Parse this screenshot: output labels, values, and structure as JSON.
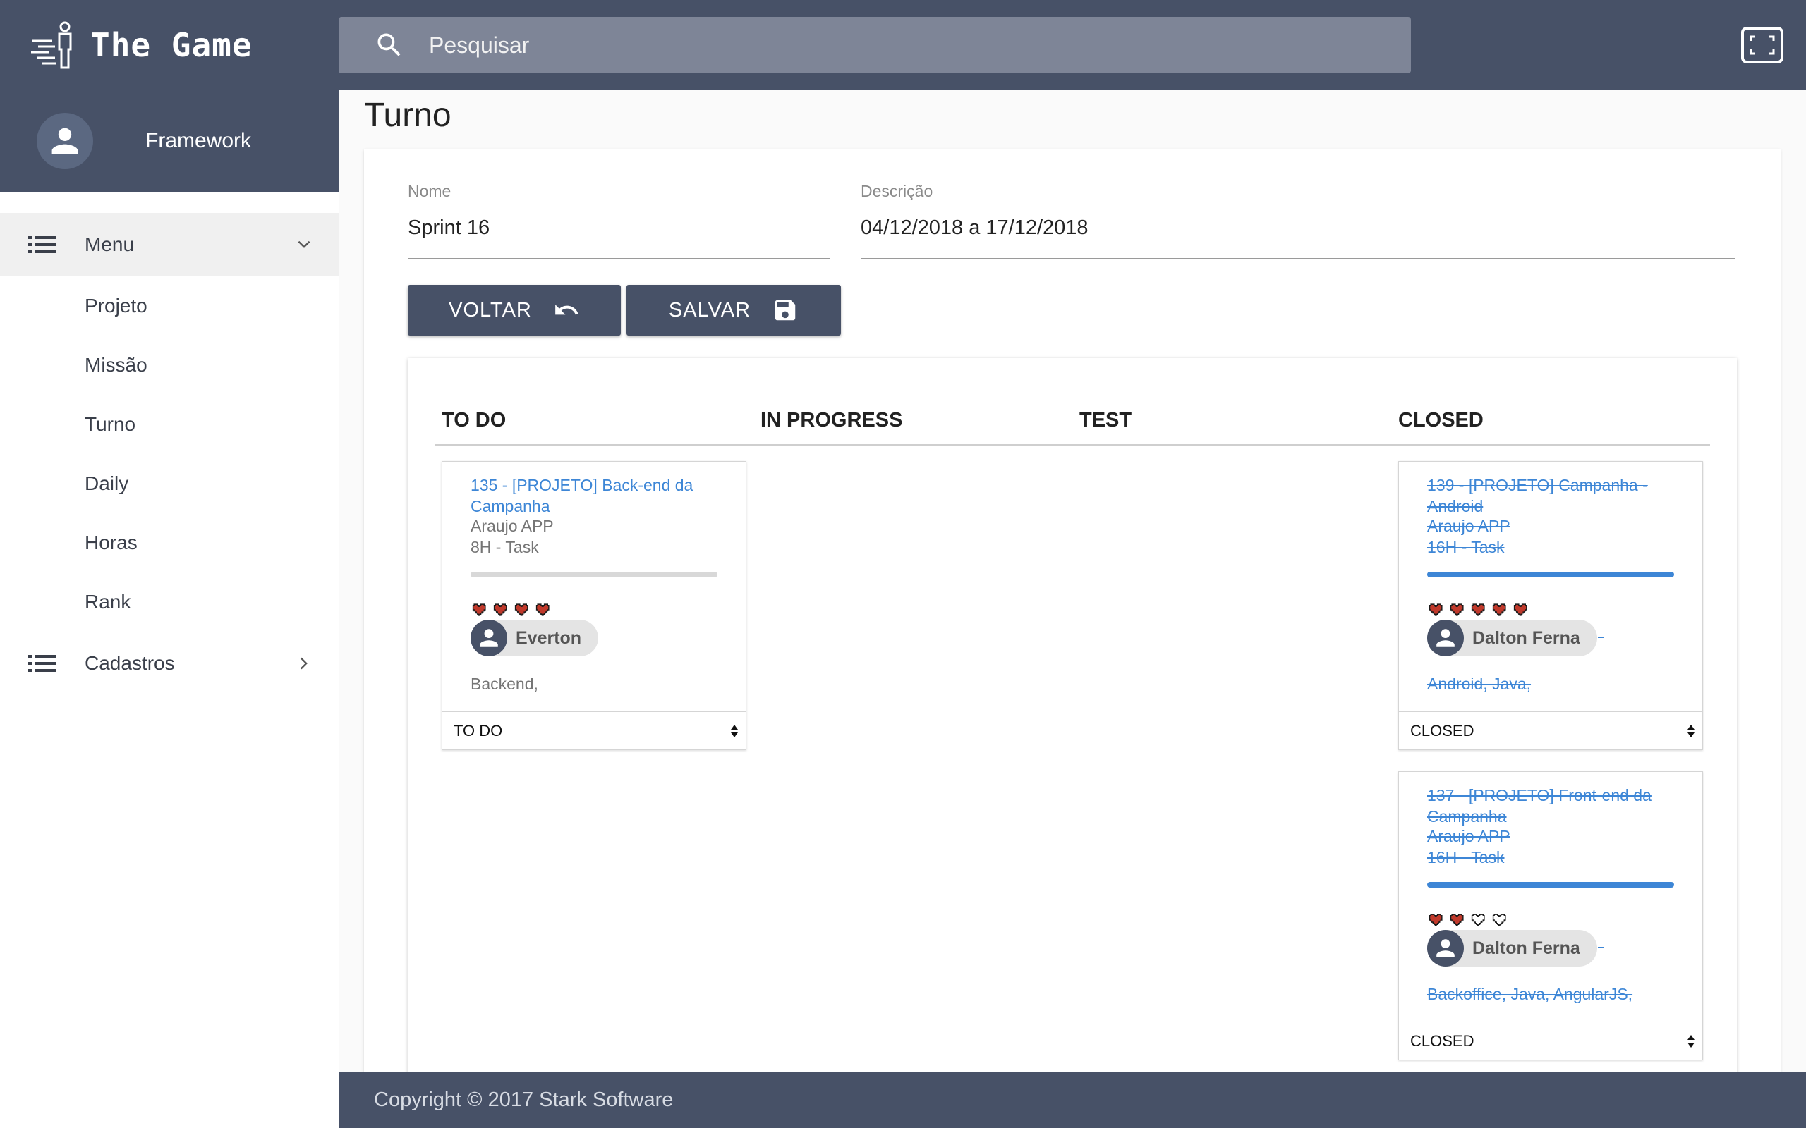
{
  "app": {
    "name": "The Game"
  },
  "search": {
    "placeholder": "Pesquisar"
  },
  "sidebar": {
    "user": "Framework",
    "menu_label": "Menu",
    "items": [
      "Projeto",
      "Missão",
      "Turno",
      "Daily",
      "Horas",
      "Rank"
    ],
    "cadastros_label": "Cadastros"
  },
  "page": {
    "title": "Turno"
  },
  "form": {
    "nome_label": "Nome",
    "nome_value": "Sprint 16",
    "descricao_label": "Descrição",
    "descricao_value": "04/12/2018 a 17/12/2018",
    "back_label": "VOLTAR",
    "save_label": "SALVAR"
  },
  "board": {
    "columns": [
      "TO DO",
      "IN PROGRESS",
      "TEST",
      "CLOSED"
    ],
    "tasks": [
      {
        "title": "135 - [PROJETO] Back-end da Campanha",
        "project": "Araujo APP",
        "hours": "8H - Task",
        "progress": 0,
        "hearts_filled": 4,
        "hearts_total": 4,
        "assignee": "Everton",
        "tags": "Backend,",
        "status": "TO DO",
        "column": "TO DO"
      },
      {
        "title": "139 - [PROJETO] Campanha - Android",
        "project": "Araujo APP",
        "hours": "16H - Task",
        "progress": 1,
        "hearts_filled": 5,
        "hearts_total": 5,
        "assignee": "Dalton Ferna",
        "tags": "Android, Java,",
        "status": "CLOSED",
        "column": "CLOSED"
      },
      {
        "title": "137 - [PROJETO] Front-end da Campanha",
        "project": "Araujo APP",
        "hours": "16H - Task",
        "progress": 1,
        "hearts_filled": 2,
        "hearts_total": 4,
        "assignee": "Dalton Ferna",
        "tags": "Backoffice, Java, AngularJS,",
        "status": "CLOSED",
        "column": "CLOSED"
      }
    ]
  },
  "footer": {
    "text": "Copyright © 2017 Stark Software"
  },
  "colors": {
    "primary": "#475167",
    "link": "#3d86d6",
    "heart": "#c0392b"
  },
  "icons": [
    "app-logo-icon",
    "search-icon",
    "fullscreen-icon",
    "avatar-icon",
    "list-icon",
    "chevron-down-icon",
    "chevron-right-icon",
    "undo-icon",
    "save-icon",
    "heart-icon",
    "select-arrows-icon"
  ]
}
